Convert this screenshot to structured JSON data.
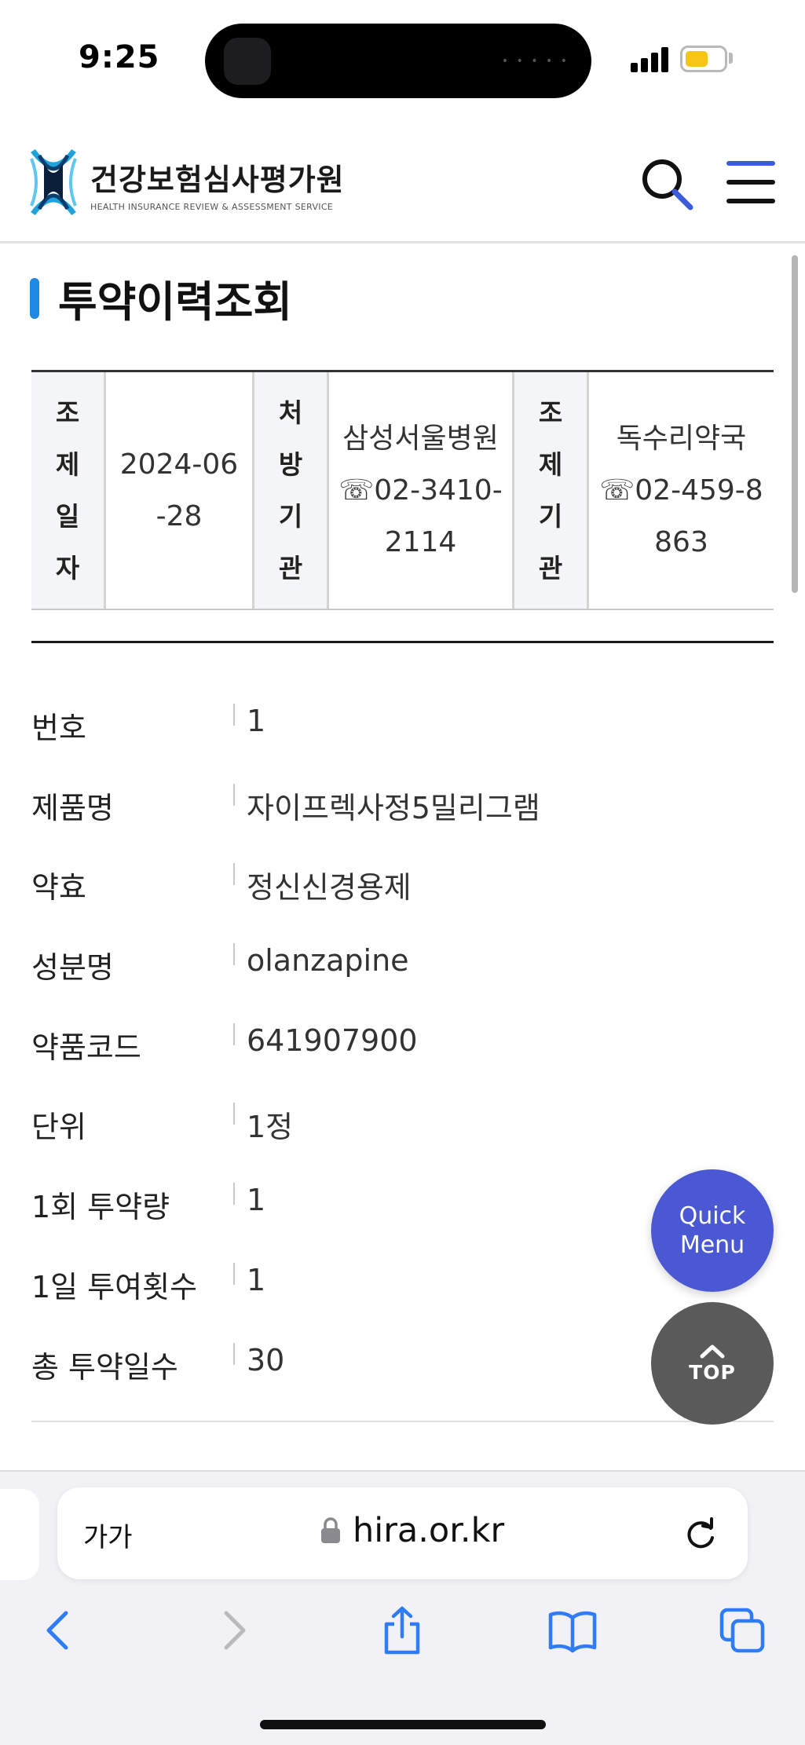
{
  "status_bar": {
    "time": "9:25",
    "battery_color": "#f5c518"
  },
  "header": {
    "logo_title": "건강보험심사평가원",
    "logo_subtitle": "HEALTH INSURANCE REVIEW & ASSESSMENT SERVICE",
    "logo_icon": "hira-logo-icon",
    "search_icon": "search-icon",
    "menu_icon": "hamburger-menu-icon",
    "accent_color": "#3b5bdb"
  },
  "page": {
    "title": "투약이력조회",
    "title_bar_color": "#1e88e5"
  },
  "info_table": {
    "dispense_date_label": "조제일자",
    "dispense_date": "2024-06-28",
    "prescriber_label": "처방기관",
    "prescriber_name": "삼성서울병원",
    "prescriber_phone": "☏02-3410-2114",
    "pharmacy_label": "조제기관",
    "pharmacy_name": "독수리약국",
    "pharmacy_phone": "☏02-459-8863"
  },
  "details": [
    {
      "label": "번호",
      "value": "1"
    },
    {
      "label": "제품명",
      "value": "자이프렉사정5밀리그램"
    },
    {
      "label": "약효",
      "value": "정신신경용제"
    },
    {
      "label": "성분명",
      "value": "olanzapine"
    },
    {
      "label": "약품코드",
      "value": "641907900"
    },
    {
      "label": "단위",
      "value": "1정"
    },
    {
      "label": "1회 투약량",
      "value": "1"
    },
    {
      "label": "1일 투여횟수",
      "value": "1"
    },
    {
      "label": "총 투약일수",
      "value": "30"
    }
  ],
  "floating": {
    "quick_menu_line1": "Quick",
    "quick_menu_line2": "Menu",
    "quick_menu_color": "#4a58d4",
    "top_label": "TOP",
    "top_color": "#5a5a5a"
  },
  "browser": {
    "aa_label": "가가",
    "url": "hira.or.kr",
    "toolbar_color": "#2f7cf6",
    "icons": [
      "back-icon",
      "forward-icon",
      "share-icon",
      "bookmarks-icon",
      "tabs-icon"
    ]
  }
}
